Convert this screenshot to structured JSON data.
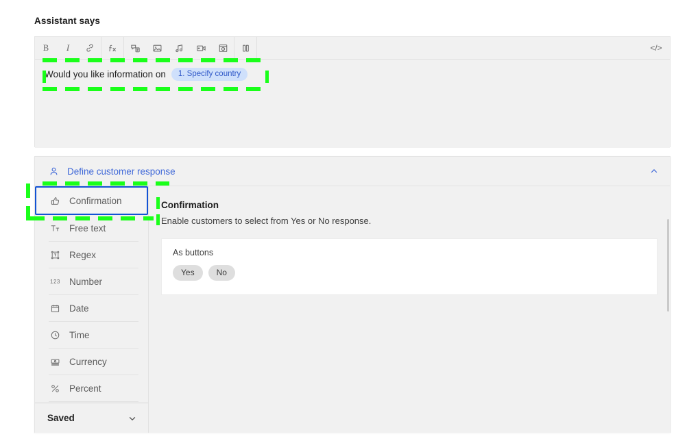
{
  "page": {
    "section_label": "Assistant says"
  },
  "editor": {
    "toolbar": {
      "items": [
        {
          "name": "bold-icon",
          "label": "B"
        },
        {
          "name": "italic-icon",
          "label": "I"
        },
        {
          "name": "link-icon",
          "label": "Link"
        },
        {
          "name": "function-icon",
          "label": "fx"
        },
        {
          "name": "dynamic-card-icon",
          "label": "Dynamic card"
        },
        {
          "name": "image-icon",
          "label": "Image"
        },
        {
          "name": "audio-icon",
          "label": "Audio"
        },
        {
          "name": "video-icon",
          "label": "Video"
        },
        {
          "name": "media-icon",
          "label": "Media"
        },
        {
          "name": "columns-icon",
          "label": "Columns"
        }
      ],
      "code_label": "</>"
    },
    "message": {
      "text": "Would you like information on",
      "chip": "1. Specify country"
    }
  },
  "response_card": {
    "header": {
      "title": "Define customer response",
      "person_icon": "person-icon",
      "collapse_icon": "chevron-up-icon"
    },
    "type_list": [
      {
        "label": "Confirmation",
        "icon": "thumbs-up-icon",
        "selected": true
      },
      {
        "label": "Free text",
        "icon": "text-format-icon",
        "selected": false
      },
      {
        "label": "Regex",
        "icon": "regex-icon",
        "selected": false
      },
      {
        "label": "Number",
        "icon": "number-123-icon",
        "selected": false
      },
      {
        "label": "Date",
        "icon": "calendar-icon",
        "selected": false
      },
      {
        "label": "Time",
        "icon": "clock-icon",
        "selected": false
      },
      {
        "label": "Currency",
        "icon": "currency-icon",
        "selected": false
      },
      {
        "label": "Percent",
        "icon": "percent-icon",
        "selected": false
      }
    ],
    "saved": {
      "label": "Saved",
      "icon": "chevron-down-icon"
    },
    "detail": {
      "title": "Confirmation",
      "description": "Enable customers to select from Yes or No response.",
      "buttons_card": {
        "label": "As buttons",
        "options": [
          "Yes",
          "No"
        ]
      }
    }
  },
  "colors": {
    "accent_blue": "#3f68d8",
    "selected_border": "#1353d4",
    "chip_bg": "#cfe0fb",
    "chip_text": "#2f58c8",
    "annotation_green": "#1aff1a",
    "panel_bg": "#f1f1f1"
  }
}
